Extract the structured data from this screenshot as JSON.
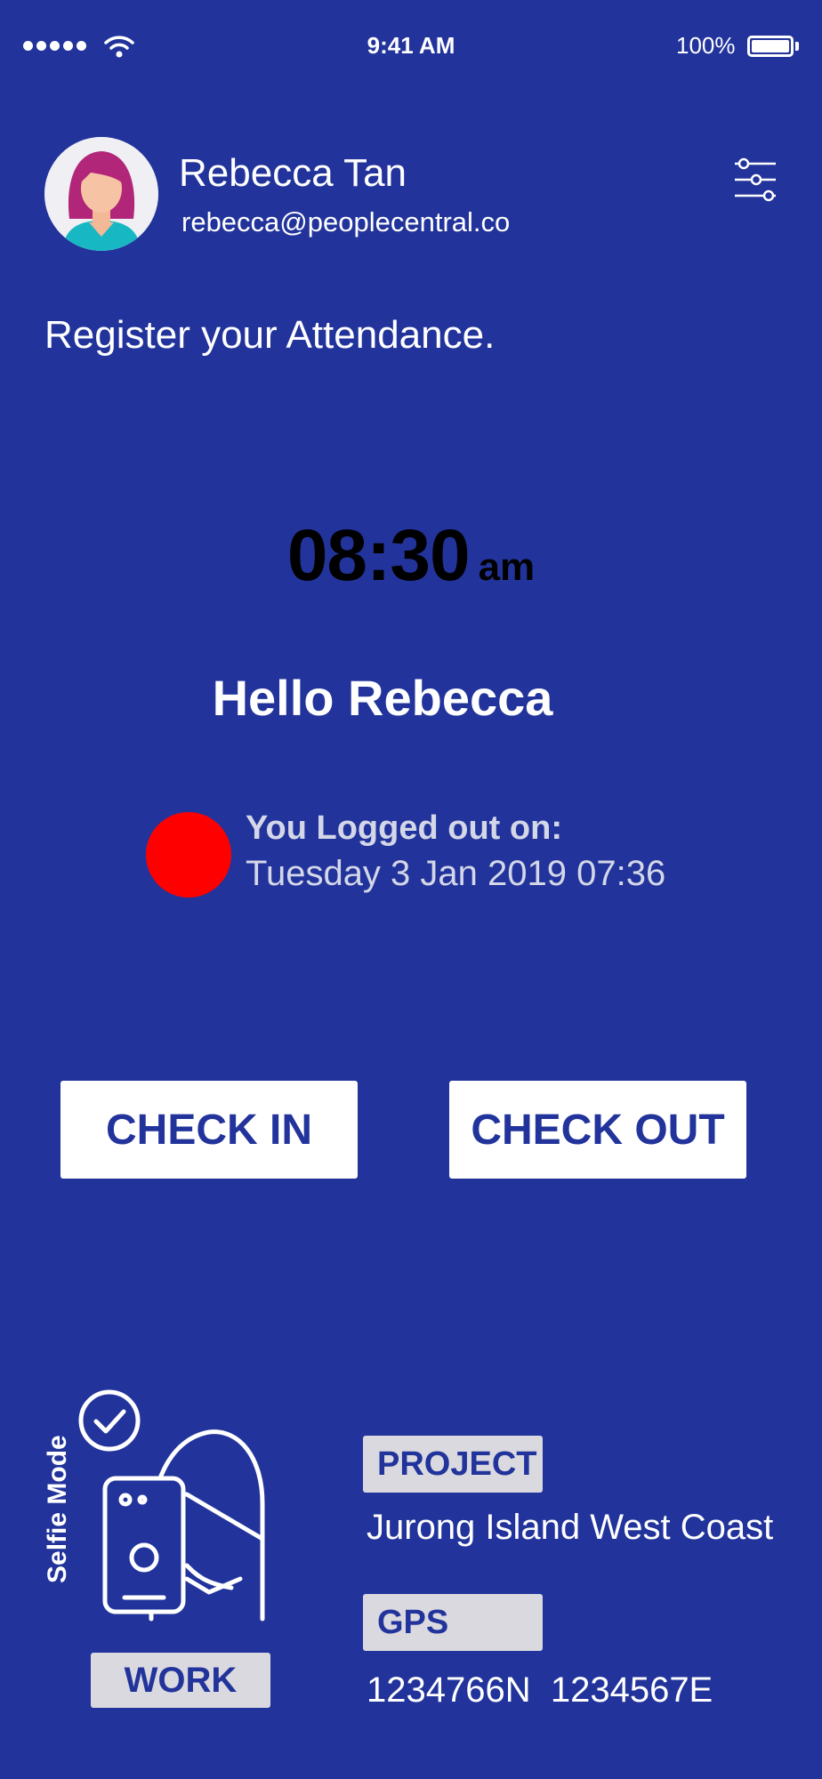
{
  "status_bar": {
    "time": "9:41 AM",
    "battery": "100%",
    "signal_icon": "signal-dots-icon",
    "wifi_icon": "wifi-icon",
    "battery_icon": "battery-icon"
  },
  "user": {
    "name": "Rebecca Tan",
    "email": "rebecca@peoplecentral.co",
    "avatar_icon": "avatar-woman-icon"
  },
  "header": {
    "filter_icon": "sliders-icon"
  },
  "page": {
    "heading": "Register your Attendance."
  },
  "clock": {
    "time": "08:30",
    "period": "am"
  },
  "greeting": "Hello Rebecca",
  "last_status": {
    "label": "You Logged out on:",
    "datetime": "Tuesday 3 Jan 2019 07:36",
    "indicator_color": "#ff0000"
  },
  "actions": {
    "check_in": "CHECK IN",
    "check_out": "CHECK OUT"
  },
  "selfie": {
    "label": "Selfie Mode",
    "mode_tag": "WORK",
    "icon": "selfie-mode-icon"
  },
  "project": {
    "tag": "PROJECT",
    "name": "Jurong Island West Coast"
  },
  "gps": {
    "tag": "GPS",
    "coordinates": "1234766N  1234567E"
  },
  "colors": {
    "background": "#22349b",
    "tag_background": "#d9d9df",
    "button_text": "#22349b"
  }
}
